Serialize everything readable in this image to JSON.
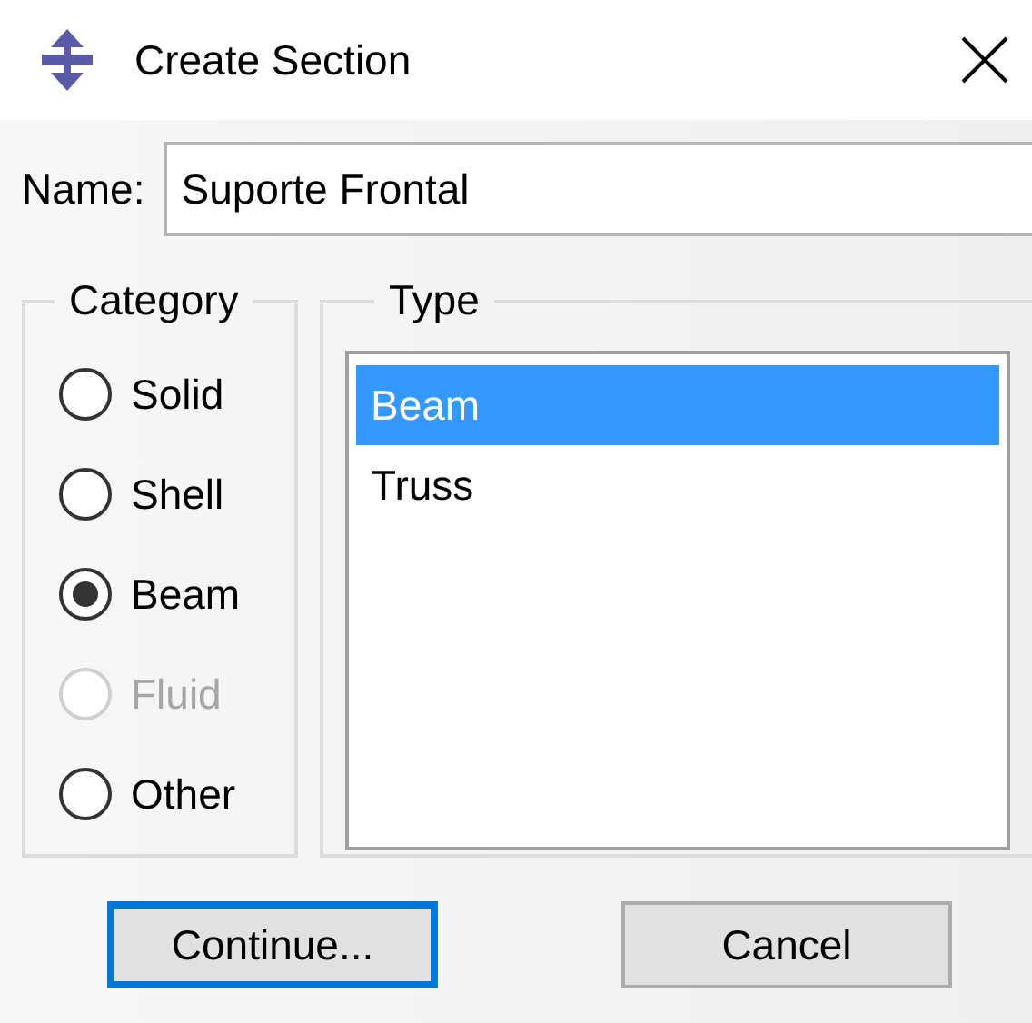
{
  "window": {
    "title": "Create Section"
  },
  "name_field": {
    "label": "Name:",
    "value": "Suporte Frontal"
  },
  "category": {
    "title": "Category",
    "options": [
      {
        "label": "Solid",
        "selected": false,
        "disabled": false
      },
      {
        "label": "Shell",
        "selected": false,
        "disabled": false
      },
      {
        "label": "Beam",
        "selected": true,
        "disabled": false
      },
      {
        "label": "Fluid",
        "selected": false,
        "disabled": true
      },
      {
        "label": "Other",
        "selected": false,
        "disabled": false
      }
    ]
  },
  "type": {
    "title": "Type",
    "items": [
      {
        "label": "Beam",
        "selected": true
      },
      {
        "label": "Truss",
        "selected": false
      }
    ]
  },
  "buttons": [
    {
      "label": "Continue...",
      "default": true
    },
    {
      "label": "Cancel",
      "default": false
    }
  ]
}
